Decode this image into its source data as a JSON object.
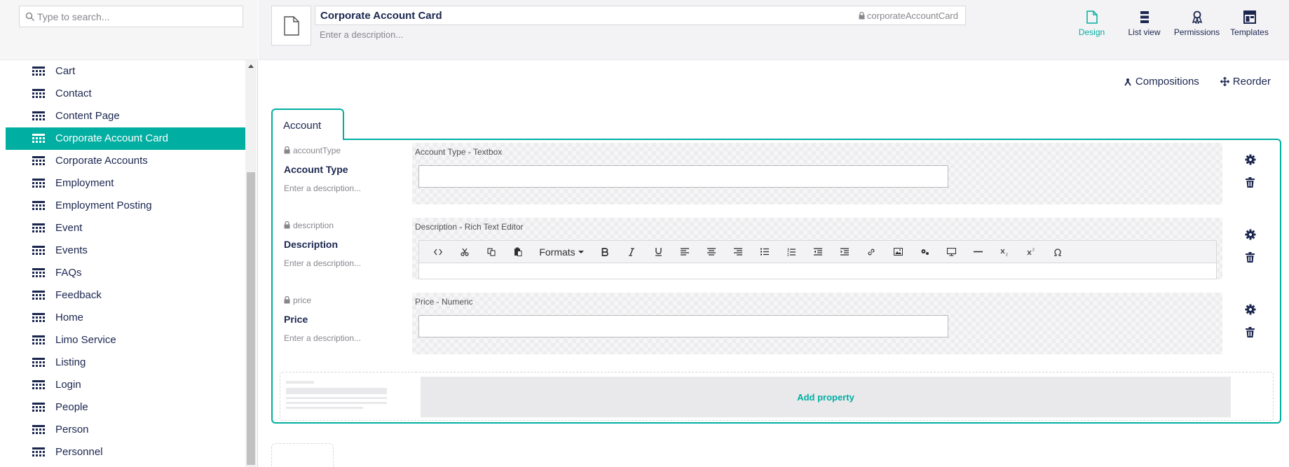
{
  "search": {
    "placeholder": "Type to search..."
  },
  "tree": {
    "items": [
      {
        "label": "Cart",
        "active": false
      },
      {
        "label": "Contact",
        "active": false
      },
      {
        "label": "Content Page",
        "active": false
      },
      {
        "label": "Corporate Account Card",
        "active": true
      },
      {
        "label": "Corporate Accounts",
        "active": false
      },
      {
        "label": "Employment",
        "active": false
      },
      {
        "label": "Employment Posting",
        "active": false
      },
      {
        "label": "Event",
        "active": false
      },
      {
        "label": "Events",
        "active": false
      },
      {
        "label": "FAQs",
        "active": false
      },
      {
        "label": "Feedback",
        "active": false
      },
      {
        "label": "Home",
        "active": false
      },
      {
        "label": "Limo Service",
        "active": false
      },
      {
        "label": "Listing",
        "active": false
      },
      {
        "label": "Login",
        "active": false
      },
      {
        "label": "People",
        "active": false
      },
      {
        "label": "Person",
        "active": false
      },
      {
        "label": "Personnel",
        "active": false
      }
    ]
  },
  "header": {
    "name": "Corporate Account Card",
    "alias": "corporateAccountCard",
    "description_placeholder": "Enter a description...",
    "actions": [
      {
        "label": "Design",
        "icon": "design-icon",
        "active": true
      },
      {
        "label": "List view",
        "icon": "list-view-icon",
        "active": false
      },
      {
        "label": "Permissions",
        "icon": "permissions-icon",
        "active": false
      },
      {
        "label": "Templates",
        "icon": "templates-icon",
        "active": false
      }
    ]
  },
  "toolbar": {
    "compositions_label": "Compositions",
    "reorder_label": "Reorder"
  },
  "group": {
    "tab_label": "Account",
    "properties": [
      {
        "alias": "accountType",
        "label": "Account Type",
        "description": "Enter a description...",
        "editor": "Account Type - Textbox",
        "type": "textbox"
      },
      {
        "alias": "description",
        "label": "Description",
        "description": "Enter a description...",
        "editor": "Description - Rich Text Editor",
        "type": "rte"
      },
      {
        "alias": "price",
        "label": "Price",
        "description": "Enter a description...",
        "editor": "Price - Numeric",
        "type": "numeric"
      }
    ],
    "add_property_label": "Add property"
  },
  "rte": {
    "formats_label": "Formats"
  },
  "colors": {
    "accent": "#00aea2",
    "text": "#1b264f",
    "muted": "#88868d"
  }
}
